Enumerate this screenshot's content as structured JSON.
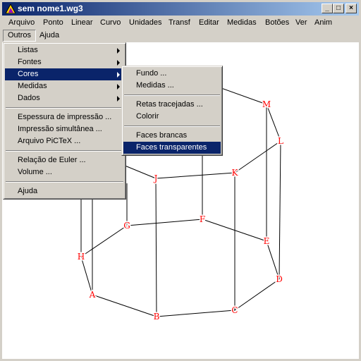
{
  "window": {
    "title": "sem nome1.wg3",
    "minimize": "_",
    "maximize": "□",
    "close": "×"
  },
  "menubar": [
    "Arquivo",
    "Ponto",
    "Linear",
    "Curvo",
    "Unidades",
    "Transf",
    "Editar",
    "Medidas",
    "Botões",
    "Ver",
    "Anim",
    "Outros",
    "Ajuda"
  ],
  "outros_menu": {
    "groups": [
      [
        {
          "label": "Listas",
          "submenu": true
        },
        {
          "label": "Fontes",
          "submenu": true
        },
        {
          "label": "Cores",
          "submenu": true,
          "selected": true
        },
        {
          "label": "Medidas",
          "submenu": true
        },
        {
          "label": "Dados",
          "submenu": true
        }
      ],
      [
        {
          "label": "Espessura de impressão ..."
        },
        {
          "label": "Impressão simultânea ..."
        },
        {
          "label": "Arquivo PiCTeX ..."
        }
      ],
      [
        {
          "label": "Relação de Euler ..."
        },
        {
          "label": "Volume ..."
        }
      ],
      [
        {
          "label": "Ajuda"
        }
      ]
    ]
  },
  "cores_submenu": {
    "groups": [
      [
        {
          "label": "Fundo ..."
        },
        {
          "label": "Medidas ..."
        }
      ],
      [
        {
          "label": "Retas tracejadas ..."
        },
        {
          "label": "Colorir"
        }
      ],
      [
        {
          "label": "Faces brancas"
        },
        {
          "label": "Faces transparentes",
          "selected": true
        }
      ]
    ]
  },
  "figure": {
    "label_color": "#ff0000",
    "line_color": "#000000",
    "points": [
      "A",
      "B",
      "C",
      "D",
      "E",
      "F",
      "G",
      "H",
      "J",
      "K",
      "L",
      "M"
    ]
  }
}
